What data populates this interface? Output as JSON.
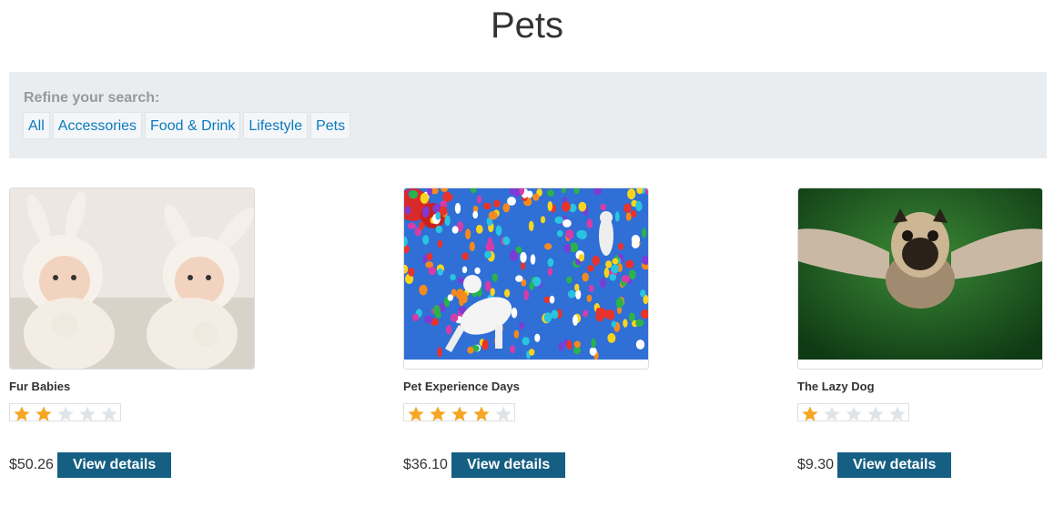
{
  "page": {
    "title": "Pets"
  },
  "filters": {
    "label": "Refine your search:",
    "links": [
      "All",
      "Accessories",
      "Food & Drink",
      "Lifestyle",
      "Pets"
    ]
  },
  "products": [
    {
      "title": "Fur Babies",
      "rating": 2,
      "rating_max": 5,
      "price": "$50.26",
      "button": "View details"
    },
    {
      "title": "Pet Experience Days",
      "rating": 4,
      "rating_max": 5,
      "price": "$36.10",
      "button": "View details"
    },
    {
      "title": "The Lazy Dog",
      "rating": 1,
      "rating_max": 5,
      "price": "$9.30",
      "button": "View details"
    }
  ],
  "colors": {
    "star_filled": "#f5a623",
    "star_empty": "#dfe4e8",
    "button": "#155f82",
    "link": "#0a7bbf"
  }
}
